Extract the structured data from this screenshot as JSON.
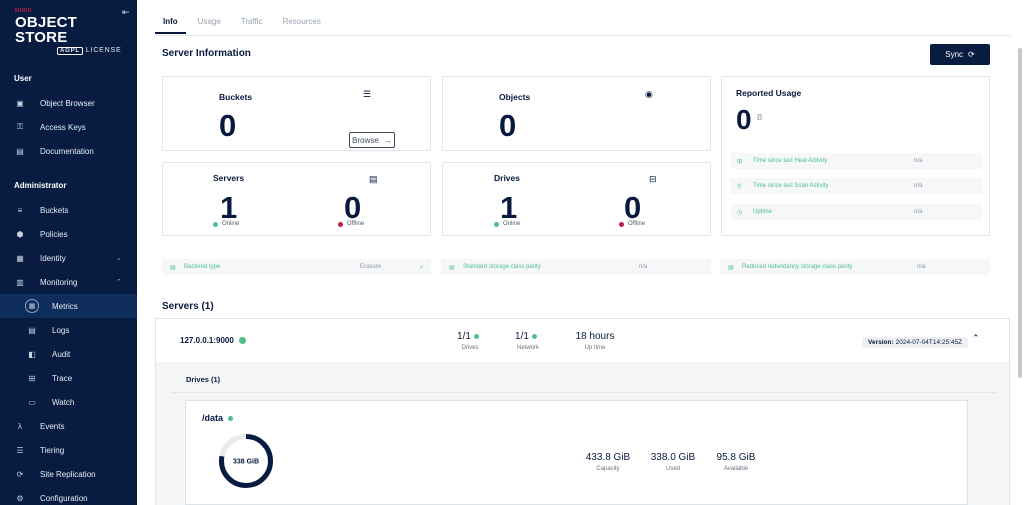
{
  "sidebar": {
    "logo": {
      "brand": "MINIO",
      "title": "OBJECT STORE",
      "agpl": "AGPL",
      "license": "LICENSE"
    },
    "user_section": "User",
    "user_items": [
      {
        "label": "Object Browser",
        "icon": "object-browser-icon"
      },
      {
        "label": "Access Keys",
        "icon": "key-icon"
      },
      {
        "label": "Documentation",
        "icon": "document-icon"
      }
    ],
    "admin_section": "Administrator",
    "admin_items": [
      {
        "label": "Buckets",
        "icon": "bucket-icon"
      },
      {
        "label": "Policies",
        "icon": "shield-icon"
      },
      {
        "label": "Identity",
        "icon": "identity-icon",
        "expandable": true
      },
      {
        "label": "Monitoring",
        "icon": "monitoring-icon",
        "expanded": true
      },
      {
        "label": "Metrics",
        "icon": "metrics-icon",
        "active": true
      },
      {
        "label": "Logs",
        "icon": "logs-icon"
      },
      {
        "label": "Audit",
        "icon": "audit-icon"
      },
      {
        "label": "Trace",
        "icon": "trace-icon"
      },
      {
        "label": "Watch",
        "icon": "watch-icon"
      },
      {
        "label": "Events",
        "icon": "lambda-icon"
      },
      {
        "label": "Tiering",
        "icon": "tiering-icon"
      },
      {
        "label": "Site Replication",
        "icon": "replication-icon"
      },
      {
        "label": "Configuration",
        "icon": "gear-icon"
      }
    ]
  },
  "tabs": [
    "Info",
    "Usage",
    "Traffic",
    "Resources"
  ],
  "active_tab": "Info",
  "server_info": {
    "title": "Server Information",
    "sync_label": "Sync",
    "buckets": {
      "label": "Buckets",
      "value": "0",
      "browse": "Browse"
    },
    "objects": {
      "label": "Objects",
      "value": "0"
    },
    "servers": {
      "label": "Servers",
      "online": "1",
      "offline": "0",
      "online_label": "Online",
      "offline_label": "Offline"
    },
    "drives": {
      "label": "Drives",
      "online": "1",
      "offline": "0",
      "online_label": "Online",
      "offline_label": "Offline"
    },
    "reported_usage": {
      "label": "Reported Usage",
      "value": "0",
      "unit": "B",
      "rows": [
        {
          "label": "Time since last Heal Activity",
          "value": "n/a"
        },
        {
          "label": "Time since last Scan Activity",
          "value": "n/a"
        },
        {
          "label": "Uptime",
          "value": "n/a"
        }
      ]
    },
    "backend_type": {
      "label": "Backend type",
      "value": "Erasure"
    },
    "standard_parity": {
      "label": "Standard storage class parity",
      "value": "n/a"
    },
    "reduced_parity": {
      "label": "Reduced redundancy storage class parity",
      "value": "n/a"
    }
  },
  "servers_section": {
    "title": "Servers (1)",
    "server": {
      "address": "127.0.0.1:9000",
      "drives": {
        "value": "1/1",
        "label": "Drives"
      },
      "network": {
        "value": "1/1",
        "label": "Network"
      },
      "uptime": {
        "value": "18 hours",
        "label": "Up time"
      },
      "version_label": "Version:",
      "version": "2024-07-04T14:25:45Z"
    },
    "drives_title": "Drives (1)",
    "drive": {
      "path": "/data",
      "donut_label": "338 GiB",
      "used_fraction": 0.78,
      "capacity": {
        "value": "433.8 GiB",
        "label": "Capacity"
      },
      "used": {
        "value": "338.0 GiB",
        "label": "Used"
      },
      "available": {
        "value": "95.8 GiB",
        "label": "Available"
      }
    }
  },
  "colors": {
    "navy": "#081c42",
    "green": "#4cbf8d",
    "red": "#c51c3f"
  }
}
